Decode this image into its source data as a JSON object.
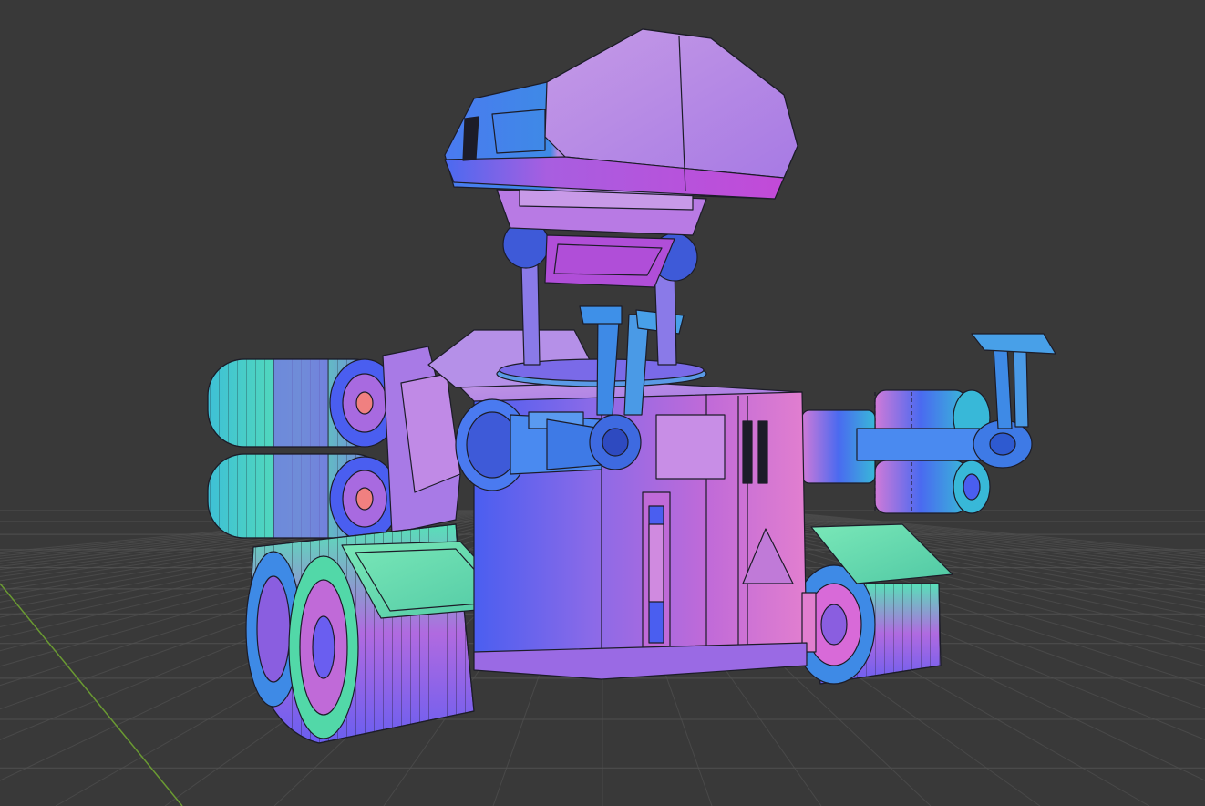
{
  "viewport": {
    "mode": "3d-viewport",
    "shading": "normal-map-wireframe",
    "background_color": "#393939",
    "grid_color": "#505050",
    "y_axis_color": "#6a9a32",
    "palette": {
      "magenta": "#c06ad8",
      "violet": "#8a5ee0",
      "blue": "#4a5ef0",
      "cyan": "#48c8d8",
      "teal": "#52d8a8",
      "pink": "#e860c8",
      "wire": "#1c1c28"
    },
    "object": {
      "icon": "vehicle-icon"
    }
  }
}
